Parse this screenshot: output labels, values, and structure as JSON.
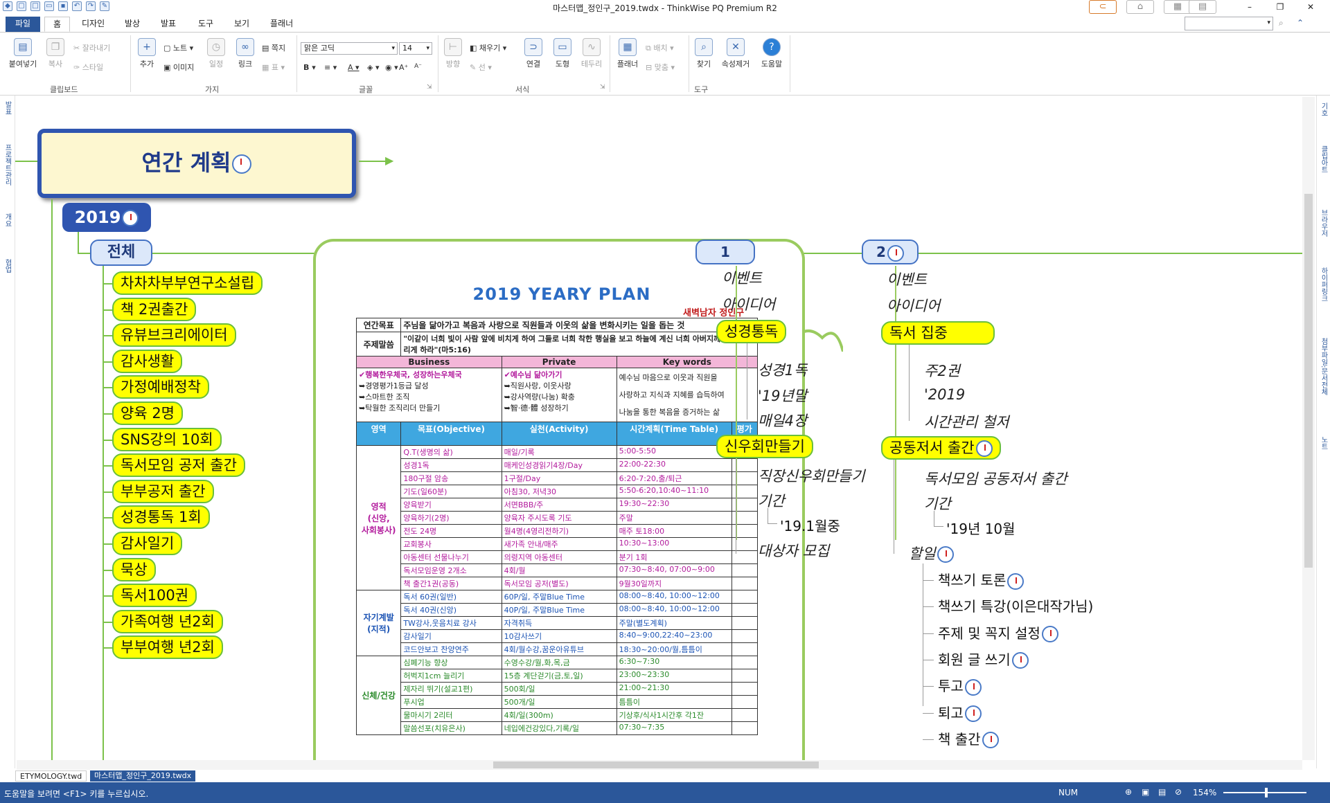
{
  "window": {
    "title": "마스터맵_정인구_2019.twdx - ThinkWise PQ Premium R2",
    "minimize": "–",
    "restore": "❐",
    "close": "✕"
  },
  "tabs": [
    "파일",
    "홈",
    "디자인",
    "발상",
    "발표",
    "도구",
    "보기",
    "플래너"
  ],
  "ribbon": {
    "paste": "붙여넣기",
    "copy": "복사",
    "cut": "잘라내기",
    "style": "스타일",
    "group_clipboard": "클립보드",
    "add": "추가",
    "note": "노트",
    "image": "이미지",
    "schedule": "일정",
    "link": "링크",
    "page": "쪽지",
    "table": "표",
    "group_branch": "가지",
    "font_name": "맑은 고딕",
    "font_size": "14",
    "group_font": "글꼴",
    "direction": "방향",
    "fill": "채우기",
    "line": "선",
    "connect": "연결",
    "shape": "도형",
    "border": "테두리",
    "group_format": "서식",
    "planner": "플래너",
    "arrange": "배치",
    "fit": "맞춤",
    "find": "찾기",
    "remove_attr": "속성제거",
    "help": "도움말",
    "group_tools": "도구"
  },
  "left_panel": [
    "발표",
    "프로젝트관리",
    "개요",
    "협업"
  ],
  "right_panel": [
    "기호",
    "클립아트",
    "브라우저",
    "하이퍼링크",
    "첨부파일:문서전체",
    "노트"
  ],
  "map": {
    "root": "연간 계획",
    "year": "2019",
    "all": "전체",
    "goals": [
      "차차차부부연구소설립",
      "책 2권출간",
      "유뷰브크리에이터",
      "감사생활",
      "가정예배정착",
      "양육 2명",
      "SNS강의 10회",
      "독서모임 공저 출간",
      "부부공저 출간",
      "성경통독 1회",
      "감사일기",
      "묵상",
      "독서100권",
      "가족여행 년2회",
      "부부여행 년2회"
    ],
    "month1": {
      "label": "1",
      "event": "이벤트",
      "idea": "아이디어",
      "bible": "성경통독",
      "bible_items": [
        "성경1독",
        "'19년말",
        "매일4장"
      ],
      "new_couple": "신우회만들기",
      "new_couple_items": [
        "직장신우회만들기",
        "기간",
        "'19.1월중",
        "대상자 모집"
      ]
    },
    "month2": {
      "label": "2",
      "event": "이벤트",
      "idea": "아이디어",
      "reading": "독서 집중",
      "reading_items": [
        "주2권",
        "'2019",
        "시간관리 철저"
      ],
      "coauthor": "공동저서 출간",
      "coauthor_items": [
        "독서모임 공동저서 출간",
        "기간",
        "'19년 10월",
        "할일"
      ],
      "todo": [
        "책쓰기  토론",
        "책쓰기 특강(이은대작가님)",
        "주제 및 꼭지 설정",
        "회원 글 쓰기",
        "투고",
        "퇴고",
        "책 출간"
      ]
    }
  },
  "plan": {
    "title": "2019 YEARY PLAN",
    "author": "새벽남자 정인구",
    "goal_label": "연간목표",
    "goal": "주님을 닮아가고 복음과 사랑으로 직원들과 이웃의 삶을 변화시키는 일을 돕는 것",
    "verse_label": "주제말씀",
    "verse": "\"이같이 너희 빛이 사람 앞에 비치게 하여 그들로 너희 착한 행실을 보고 하늘에 계신 너희 아버지께 영광을 돌리게 하라\"(마5:16)",
    "col_business": "Business",
    "col_private": "Private",
    "col_keywords": "Key words",
    "business": [
      "✔행복한우체국, 성장하는우체국",
      "➥경영평가1등급 달성",
      "➥스마트한 조직",
      "➥탁월한 조직리더 만들기"
    ],
    "private": [
      "✔예수님 닮아가기",
      "➥직원사랑, 이웃사랑",
      "➥강사역량(나눔) 확충",
      "➥智·德·體 성장하기"
    ],
    "keywords": [
      "예수님 마음으로 이웃과 직원을",
      "사랑하고 지식과 지혜를 습득하여",
      "나눔을 통한 복음을 증거하는 삶"
    ],
    "headers": [
      "영역",
      "목표(Objective)",
      "실천(Activity)",
      "시간계획(Time Table)",
      "평가(E)"
    ],
    "area1": "영적\n(신앙,\n사회봉사)",
    "rows1": [
      [
        "Q.T(생명의 삶)",
        "매일/기록",
        "5:00-5:50"
      ],
      [
        "성경1독",
        "매케인성경읽기4장/Day",
        "22:00-22:30"
      ],
      [
        "180구절 암송",
        "1구절/Day",
        "6:20-7:20,출/퇴근"
      ],
      [
        "기도(일60분)",
        "아침30, 저녁30",
        "5:50-6:20,10:40~11:10"
      ],
      [
        "양육받기",
        "서면BBB/주",
        "19:30~22:30"
      ],
      [
        "양육하기(2명)",
        "양육자 주시도록 기도",
        "주말"
      ],
      [
        "전도 24명",
        "월4명(4영리전하기)",
        "매주 토18:00"
      ],
      [
        "교회봉사",
        "새가족 안내/매주",
        "10:30~13:00"
      ],
      [
        "아동센터 선물나누기",
        "의령지역 아동센터",
        "분기 1회"
      ],
      [
        "독서모임운영 2개소",
        "4회/월",
        "07:30~8:40, 07:00~9:00"
      ],
      [
        "책 출간1권(공동)",
        "독서모임 공저(별도)",
        "9월30일까지"
      ]
    ],
    "area2": "자기계발\n(지적)",
    "rows2": [
      [
        "독서 60권(일반)",
        "60P/일, 주말Blue Time",
        "08:00~8:40, 10:00~12:00"
      ],
      [
        "독서 40권(신앙)",
        "40P/일, 주말Blue Time",
        "08:00~8:40, 10:00~12:00"
      ],
      [
        "TW강사,웃음치료 강사",
        "자격취득",
        "주말(별도계획)"
      ],
      [
        "감사일기",
        "10감사쓰기",
        "8:40~9:00,22:40~23:00"
      ],
      [
        "코드안보고 찬양연주",
        "4회/월수강,꿈운아유튜브",
        "18:30~20:00/월,틈틈이"
      ]
    ],
    "area3": "신체/건강",
    "rows3": [
      [
        "심폐기능 향상",
        "수영수강/월,화,목,금",
        "6:30~7:30"
      ],
      [
        "허벅지1cm 늘리기",
        "15층 계단걷기(금,토,일)",
        "23:00~23:30"
      ],
      [
        "제자리 뛰기(설교1편)",
        "500회/일",
        "21:00~21:30"
      ],
      [
        "푸시업",
        "500개/일",
        "틈틈이"
      ],
      [
        "물마시기 2리터",
        "4회/일(300m)",
        "기상후/식사1시간후 각1잔"
      ],
      [
        "말씀선포(치유은사)",
        "네입에건강있다,기록/일",
        "07:30~7:35"
      ]
    ]
  },
  "doc_tabs": [
    "ETYMOLOGY.twd",
    "마스터맵_정인구_2019.twdx"
  ],
  "status": {
    "hint": "도움말을 보려면 <F1> 키를 누르십시오.",
    "num": "NUM",
    "zoom": "154%"
  }
}
